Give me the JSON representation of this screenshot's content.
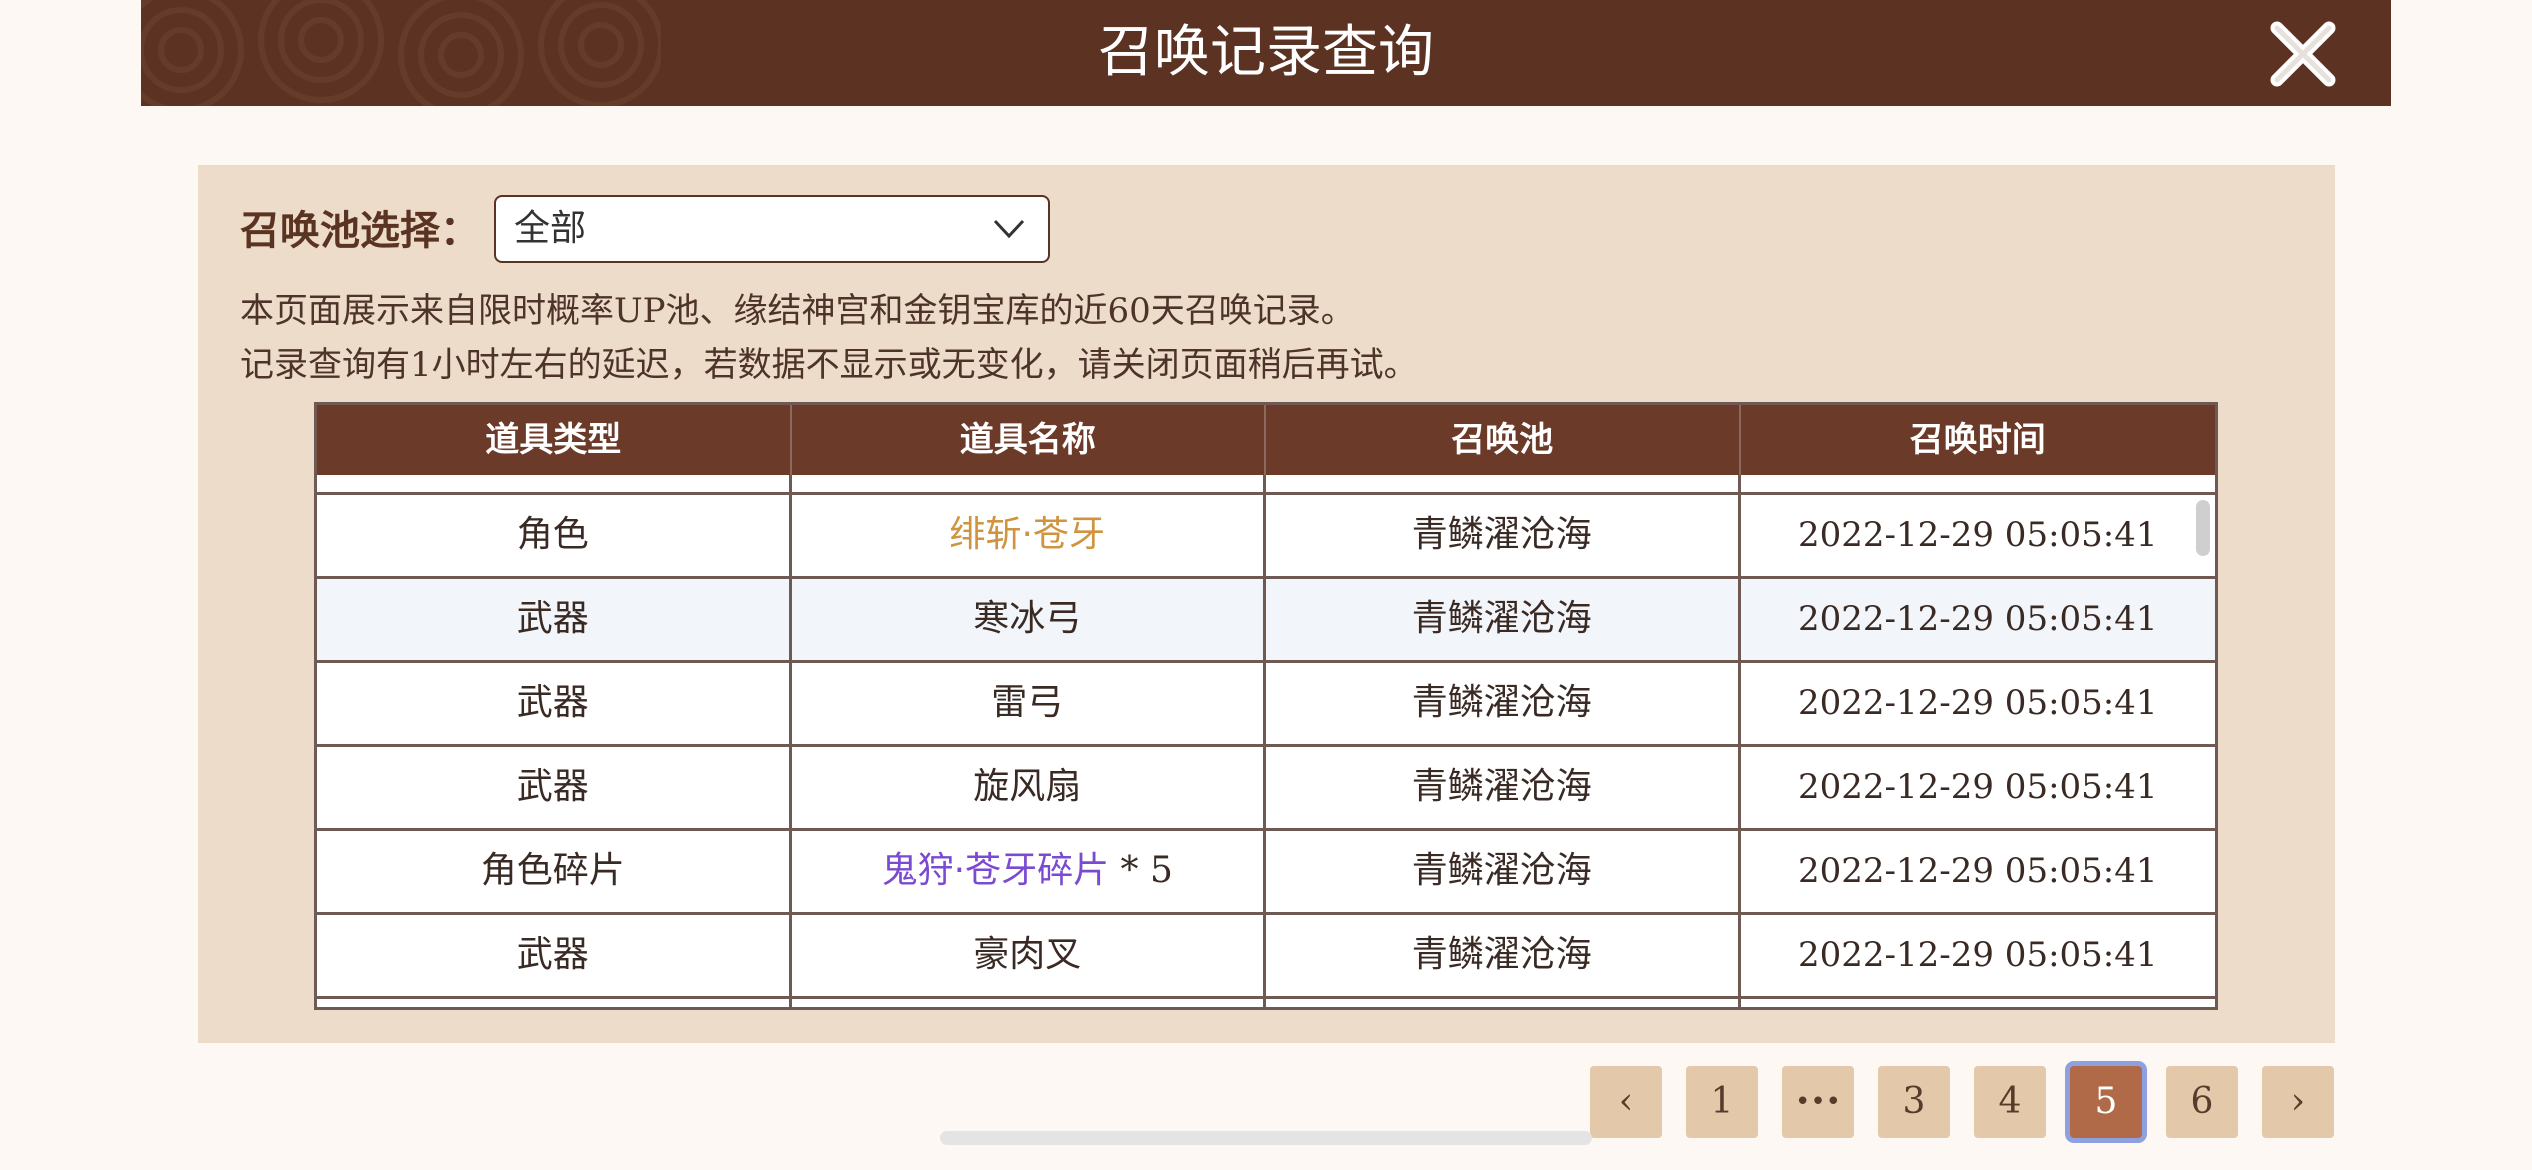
{
  "header": {
    "title": "召唤记录查询"
  },
  "filter": {
    "label": "召唤池选择：",
    "selected": "全部"
  },
  "notice": {
    "line1": "本页面展示来自限时概率UP池、缘结神宫和金钥宝库的近60天召唤记录。",
    "line2": "记录查询有1小时左右的延迟，若数据不显示或无变化，请关闭页面稍后再试。"
  },
  "table": {
    "headers": [
      "道具类型",
      "道具名称",
      "召唤池",
      "召唤时间"
    ],
    "rows": [
      {
        "type": "角色",
        "name": "绯斩·苍牙",
        "qty": "",
        "pool": "青鳞濯沧海",
        "time": "2022-12-29 05:05:41"
      },
      {
        "type": "武器",
        "name": "寒冰弓",
        "qty": "",
        "pool": "青鳞濯沧海",
        "time": "2022-12-29 05:05:41"
      },
      {
        "type": "武器",
        "name": "雷弓",
        "qty": "",
        "pool": "青鳞濯沧海",
        "time": "2022-12-29 05:05:41"
      },
      {
        "type": "武器",
        "name": "旋风扇",
        "qty": "",
        "pool": "青鳞濯沧海",
        "time": "2022-12-29 05:05:41"
      },
      {
        "type": "角色碎片",
        "name": "鬼狩·苍牙碎片",
        "qty": " * 5",
        "pool": "青鳞濯沧海",
        "time": "2022-12-29 05:05:41"
      },
      {
        "type": "武器",
        "name": "豪肉叉",
        "qty": "",
        "pool": "青鳞濯沧海",
        "time": "2022-12-29 05:05:41"
      }
    ]
  },
  "pagination": {
    "prev": "‹",
    "p1": "1",
    "ellipsis": "•••",
    "p3": "3",
    "p4": "4",
    "p5": "5",
    "p6": "6",
    "next": "›"
  },
  "colors": {
    "header_bg": "#5c3323",
    "panel_bg": "#eddcc9",
    "table_header_bg": "#6b3a28",
    "gold_name": "#d09440",
    "purple_name": "#7a4bd0",
    "page_active": "#b06a48",
    "page_btn": "#e3c8a9"
  }
}
